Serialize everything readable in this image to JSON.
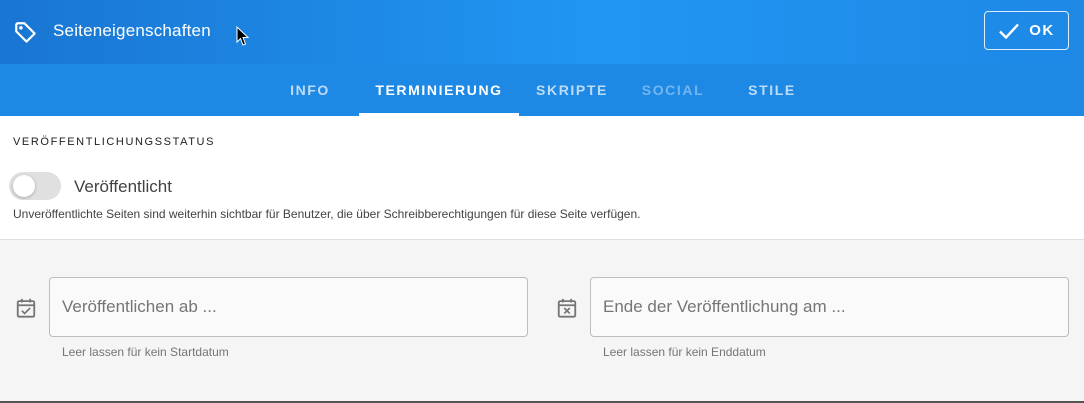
{
  "header": {
    "title": "Seiteneigenschaften",
    "icon": "tag-icon",
    "ok_label": "OK",
    "background": "#1e88e5"
  },
  "tabs": [
    {
      "label": "INFO",
      "state": "normal"
    },
    {
      "label": "TERMINIERUNG",
      "state": "active"
    },
    {
      "label": "SKRIPTE",
      "state": "normal"
    },
    {
      "label": "SOCIAL",
      "state": "disabled"
    },
    {
      "label": "STILE",
      "state": "normal"
    }
  ],
  "publish": {
    "section_title": "VERÖFFENTLICHUNGSSTATUS",
    "toggle_label": "Veröffentlicht",
    "toggle_on": false,
    "hint": "Unveröffentlichte Seiten sind weiterhin sichtbar für Benutzer, die über Schreibberechtigungen für diese Seite verfügen."
  },
  "schedule": {
    "start": {
      "placeholder": "Veröffentlichen ab ...",
      "value": "",
      "hint": "Leer lassen für kein Startdatum",
      "icon": "calendar-check-icon"
    },
    "end": {
      "placeholder": "Ende der Veröffentlichung am ...",
      "value": "",
      "hint": "Leer lassen für kein Enddatum",
      "icon": "calendar-remove-icon"
    }
  }
}
